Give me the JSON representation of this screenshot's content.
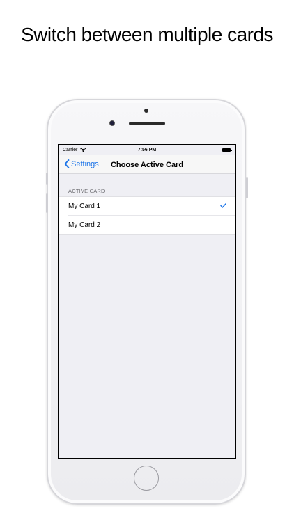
{
  "headline": "Switch between multiple cards",
  "status_bar": {
    "carrier": "Carrier",
    "time": "7:56 PM"
  },
  "nav": {
    "back_label": "Settings",
    "title": "Choose Active Card"
  },
  "section": {
    "header": "ACTIVE CARD",
    "items": [
      {
        "label": "My Card 1",
        "selected": true
      },
      {
        "label": "My Card 2",
        "selected": false
      }
    ]
  },
  "colors": {
    "accent": "#1a73e8",
    "background": "#efeff4"
  }
}
